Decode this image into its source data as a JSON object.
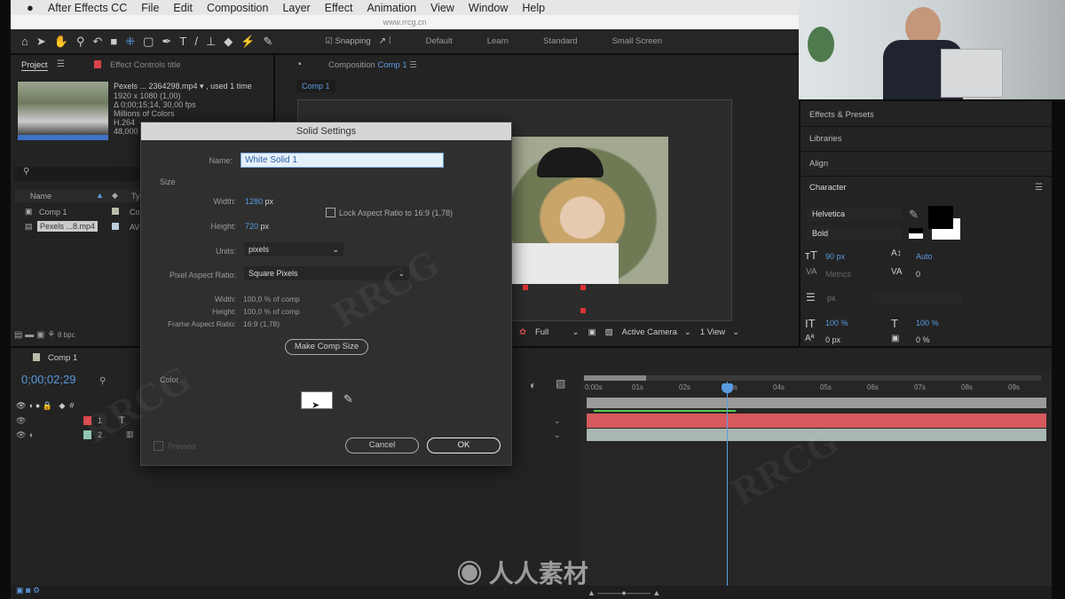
{
  "menubar": {
    "app": "After Effects CC",
    "items": [
      "File",
      "Edit",
      "Composition",
      "Layer",
      "Effect",
      "Animation",
      "View",
      "Window",
      "Help"
    ]
  },
  "titlebar": {
    "text": "www.rrcg.cn"
  },
  "toolbar": {
    "snapping": "Snapping",
    "snapping_checked": true,
    "workspaces": [
      "Default",
      "Learn",
      "Standard",
      "Small Screen"
    ]
  },
  "project": {
    "tab": "Project",
    "effect_controls": "Effect Controls title",
    "footage": {
      "name": "Pexels ... 2364298.mp4 ▾ , used 1 time",
      "lines": [
        "1920 x 1080 (1,00)",
        "Δ 0;00;15;14, 30,00 fps",
        "Millions of Colors",
        "H.264",
        "48,000"
      ]
    },
    "columns": {
      "name": "Name",
      "type": "Ty"
    },
    "items": [
      {
        "name": "Comp 1",
        "type": "Co"
      },
      {
        "name": "Pexels ...8.mp4",
        "type": "AV"
      }
    ],
    "bpc": "8 bpc"
  },
  "composition": {
    "tab_prefix": "Composition",
    "tab_name": "Comp 1",
    "subtab": "Comp 1",
    "resolution": "Full",
    "camera": "Active Camera",
    "views": "1 View"
  },
  "right": {
    "panels": [
      "Effects & Presets",
      "Libraries",
      "Align",
      "Character"
    ],
    "character": {
      "font": "Helvetica",
      "style": "Bold",
      "size": "90 px",
      "leading": "Auto",
      "kerning": "Metrics",
      "tracking": "0",
      "indent": "px",
      "vscale": "100 %",
      "hscale": "100 %",
      "baseline": "0 px",
      "tsume": "0 %"
    },
    "fill_color": "#000000",
    "stroke_color": "#ffffff"
  },
  "timeline": {
    "comp": "Comp 1",
    "timecode": "0;00;02;29",
    "ruler": [
      "0:00s",
      "01s",
      "02s",
      "03s",
      "04s",
      "05s",
      "06s",
      "07s",
      "08s",
      "09s"
    ],
    "layers": [
      {
        "num": "1",
        "color": "#d9434a",
        "kind": "T"
      },
      {
        "num": "2",
        "color": "#8fc7b0",
        "kind": "footage"
      }
    ],
    "bar_colors": {
      "text": "#d65a5e",
      "video": "#a9b7b3",
      "work": "#9a9a9a",
      "cache": "#5bc74c"
    }
  },
  "dialog": {
    "title": "Solid Settings",
    "name_label": "Name:",
    "name_value": "White Solid 1",
    "size_label": "Size",
    "width_label": "Width:",
    "width_value": "1280",
    "height_label": "Height:",
    "height_value": "720",
    "unit": "px",
    "lock_label": "Lock Aspect Ratio to 16:9 (1,78)",
    "lock_checked": false,
    "units_label": "Units:",
    "units_value": "pixels",
    "par_label": "Pixel Aspect Ratio:",
    "par_value": "Square Pixels",
    "info": [
      {
        "label": "Width:",
        "value": "100,0 % of comp"
      },
      {
        "label": "Height:",
        "value": "100,0 % of comp"
      },
      {
        "label": "Frame Aspect Ratio:",
        "value": "16:9 (1,78)"
      }
    ],
    "make_comp_size": "Make Comp Size",
    "color_label": "Color",
    "color_value": "#ffffff",
    "preview": "Preview",
    "cancel": "Cancel",
    "ok": "OK"
  },
  "watermark": {
    "text": "RRCG",
    "cn": "人人素材"
  }
}
